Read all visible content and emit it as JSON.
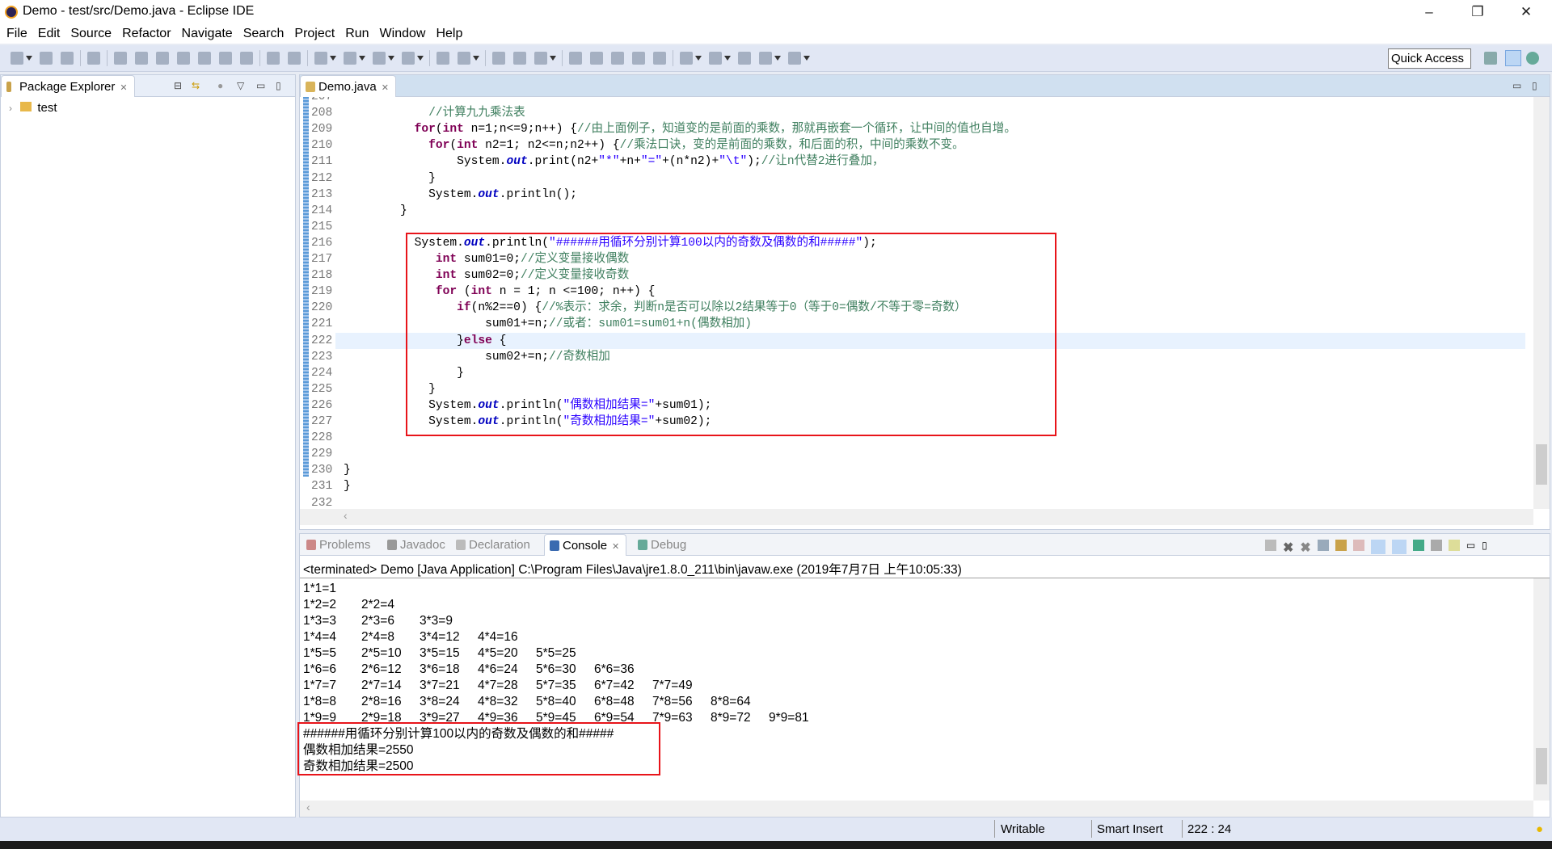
{
  "window": {
    "title": "Demo - test/src/Demo.java - Eclipse IDE",
    "minimize": "–",
    "restore": "❐",
    "close": "✕"
  },
  "menu": [
    "File",
    "Edit",
    "Source",
    "Refactor",
    "Navigate",
    "Search",
    "Project",
    "Run",
    "Window",
    "Help"
  ],
  "toolbar": {
    "quick_access": "Quick Access",
    "icons": [
      "new-icon",
      "dd",
      "save-icon",
      "save-all-icon",
      "sep",
      "skip-breakpoints-icon",
      "sep",
      "resume-icon",
      "suspend-icon",
      "terminate-icon",
      "disconnect-icon",
      "step-into-icon",
      "step-over-icon",
      "step-return-icon",
      "sep",
      "drop-to-frame-icon",
      "use-step-filters-icon",
      "sep",
      "debug-icon",
      "dd",
      "run-icon",
      "dd",
      "coverage-icon",
      "dd",
      "external-tools-icon",
      "dd",
      "sep",
      "new-java-package-icon",
      "new-java-class-icon",
      "dd",
      "sep",
      "open-type-icon",
      "open-task-icon",
      "search-icon",
      "dd",
      "sep",
      "toggle-breadcrumb-icon",
      "mark-occurrences-icon",
      "block-selection-icon",
      "word-wrap-icon",
      "show-whitespace-icon",
      "sep",
      "next-annotation-icon",
      "dd",
      "previous-annotation-icon",
      "dd",
      "last-edit-icon",
      "back-icon",
      "dd",
      "forward-icon",
      "dd"
    ]
  },
  "package_explorer": {
    "title": "Package Explorer",
    "items": [
      {
        "label": "test"
      }
    ]
  },
  "editor": {
    "tab": "Demo.java",
    "cursor_line": 222,
    "lines": [
      {
        "n": "207",
        "t": []
      },
      {
        "n": "208",
        "t": [
          [
            "p",
            "            "
          ],
          [
            "com",
            "//计算九九乘法表"
          ]
        ]
      },
      {
        "n": "209",
        "t": [
          [
            "p",
            "          "
          ],
          [
            "kw",
            "for"
          ],
          [
            "p",
            "("
          ],
          [
            "kw",
            "int"
          ],
          [
            "p",
            " n=1;n<=9;n++) {"
          ],
          [
            "com",
            "//由上面例子，知道变的是前面的乘数，那就再嵌套一个循环，让中间的值也自增。"
          ]
        ]
      },
      {
        "n": "210",
        "t": [
          [
            "p",
            "            "
          ],
          [
            "kw",
            "for"
          ],
          [
            "p",
            "("
          ],
          [
            "kw",
            "int"
          ],
          [
            "p",
            " n2=1; n2<=n;n2++) {"
          ],
          [
            "com",
            "//乘法口诀，变的是前面的乘数，和后面的积，中间的乘数不变。"
          ]
        ]
      },
      {
        "n": "211",
        "t": [
          [
            "p",
            "                System."
          ],
          [
            "fld",
            "out"
          ],
          [
            "p",
            ".print(n2+"
          ],
          [
            "str",
            "\"*\""
          ],
          [
            "p",
            "+n+"
          ],
          [
            "str",
            "\"=\""
          ],
          [
            "p",
            "+(n*n2)+"
          ],
          [
            "str",
            "\"\\t\""
          ],
          [
            "p",
            ");"
          ],
          [
            "com",
            "//让n代替2进行叠加，"
          ]
        ]
      },
      {
        "n": "212",
        "t": [
          [
            "p",
            "            }"
          ]
        ]
      },
      {
        "n": "213",
        "t": [
          [
            "p",
            "            System."
          ],
          [
            "fld",
            "out"
          ],
          [
            "p",
            ".println();"
          ]
        ]
      },
      {
        "n": "214",
        "t": [
          [
            "p",
            "        }"
          ]
        ]
      },
      {
        "n": "215",
        "t": []
      },
      {
        "n": "216",
        "t": [
          [
            "p",
            "          System."
          ],
          [
            "fld",
            "out"
          ],
          [
            "p",
            ".println("
          ],
          [
            "str",
            "\"######用循环分别计算100以内的奇数及偶数的和#####\""
          ],
          [
            "p",
            ");"
          ]
        ]
      },
      {
        "n": "217",
        "t": [
          [
            "p",
            "             "
          ],
          [
            "kw",
            "int"
          ],
          [
            "p",
            " sum01=0;"
          ],
          [
            "com",
            "//定义变量接收偶数"
          ]
        ]
      },
      {
        "n": "218",
        "t": [
          [
            "p",
            "             "
          ],
          [
            "kw",
            "int"
          ],
          [
            "p",
            " sum02=0;"
          ],
          [
            "com",
            "//定义变量接收奇数"
          ]
        ]
      },
      {
        "n": "219",
        "t": [
          [
            "p",
            "             "
          ],
          [
            "kw",
            "for"
          ],
          [
            "p",
            " ("
          ],
          [
            "kw",
            "int"
          ],
          [
            "p",
            " n = 1; n <=100; n++) {"
          ]
        ]
      },
      {
        "n": "220",
        "t": [
          [
            "p",
            "                "
          ],
          [
            "kw",
            "if"
          ],
          [
            "p",
            "(n%2==0) {"
          ],
          [
            "com",
            "//%表示：求余，判断n是否可以除以2结果等于0（等于0=偶数/不等于零=奇数）"
          ]
        ]
      },
      {
        "n": "221",
        "t": [
          [
            "p",
            "                    sum01+=n;"
          ],
          [
            "com",
            "//或者：sum01=sum01+n(偶数相加)"
          ]
        ]
      },
      {
        "n": "222",
        "t": [
          [
            "p",
            "                }"
          ],
          [
            "kw",
            "else"
          ],
          [
            "p",
            " {"
          ]
        ]
      },
      {
        "n": "223",
        "t": [
          [
            "p",
            "                    sum02+=n;"
          ],
          [
            "com",
            "//奇数相加"
          ]
        ]
      },
      {
        "n": "224",
        "t": [
          [
            "p",
            "                }"
          ]
        ]
      },
      {
        "n": "225",
        "t": [
          [
            "p",
            "            }"
          ]
        ]
      },
      {
        "n": "226",
        "t": [
          [
            "p",
            "            System."
          ],
          [
            "fld",
            "out"
          ],
          [
            "p",
            ".println("
          ],
          [
            "str",
            "\"偶数相加结果=\""
          ],
          [
            "p",
            "+sum01);"
          ]
        ]
      },
      {
        "n": "227",
        "t": [
          [
            "p",
            "            System."
          ],
          [
            "fld",
            "out"
          ],
          [
            "p",
            ".println("
          ],
          [
            "str",
            "\"奇数相加结果=\""
          ],
          [
            "p",
            "+sum02);"
          ]
        ]
      },
      {
        "n": "228",
        "t": []
      },
      {
        "n": "229",
        "t": []
      },
      {
        "n": "230",
        "t": [
          [
            "p",
            "}"
          ]
        ]
      },
      {
        "n": "231",
        "t": [
          [
            "p",
            "}"
          ]
        ]
      },
      {
        "n": "232",
        "t": []
      }
    ]
  },
  "bottom_panel": {
    "tabs": [
      "Problems",
      "Javadoc",
      "Declaration",
      "Console",
      "Debug"
    ],
    "active": "Console",
    "console_header": "<terminated> Demo [Java Application] C:\\Program Files\\Java\\jre1.8.0_211\\bin\\javaw.exe (2019年7月7日 上午10:05:33)",
    "table": [
      [
        "1*1=1"
      ],
      [
        "1*2=2",
        "2*2=4"
      ],
      [
        "1*3=3",
        "2*3=6",
        "3*3=9"
      ],
      [
        "1*4=4",
        "2*4=8",
        "3*4=12",
        "4*4=16"
      ],
      [
        "1*5=5",
        "2*5=10",
        "3*5=15",
        "4*5=20",
        "5*5=25"
      ],
      [
        "1*6=6",
        "2*6=12",
        "3*6=18",
        "4*6=24",
        "5*6=30",
        "6*6=36"
      ],
      [
        "1*7=7",
        "2*7=14",
        "3*7=21",
        "4*7=28",
        "5*7=35",
        "6*7=42",
        "7*7=49"
      ],
      [
        "1*8=8",
        "2*8=16",
        "3*8=24",
        "4*8=32",
        "5*8=40",
        "6*8=48",
        "7*8=56",
        "8*8=64"
      ],
      [
        "1*9=9",
        "2*9=18",
        "3*9=27",
        "4*9=36",
        "5*9=45",
        "6*9=54",
        "7*9=63",
        "8*9=72",
        "9*9=81"
      ]
    ],
    "result_lines": [
      "######用循环分别计算100以内的奇数及偶数的和#####",
      "偶数相加结果=2550",
      "奇数相加结果=2500"
    ]
  },
  "status": {
    "writable": "Writable",
    "insert_mode": "Smart Insert",
    "position": "222 : 24"
  },
  "colors": {
    "keyword": "#7f0055",
    "string": "#2a00ff",
    "comment": "#3f7f5f",
    "highlight_box": "#e8141a",
    "current_line": "#e8f2fe"
  }
}
